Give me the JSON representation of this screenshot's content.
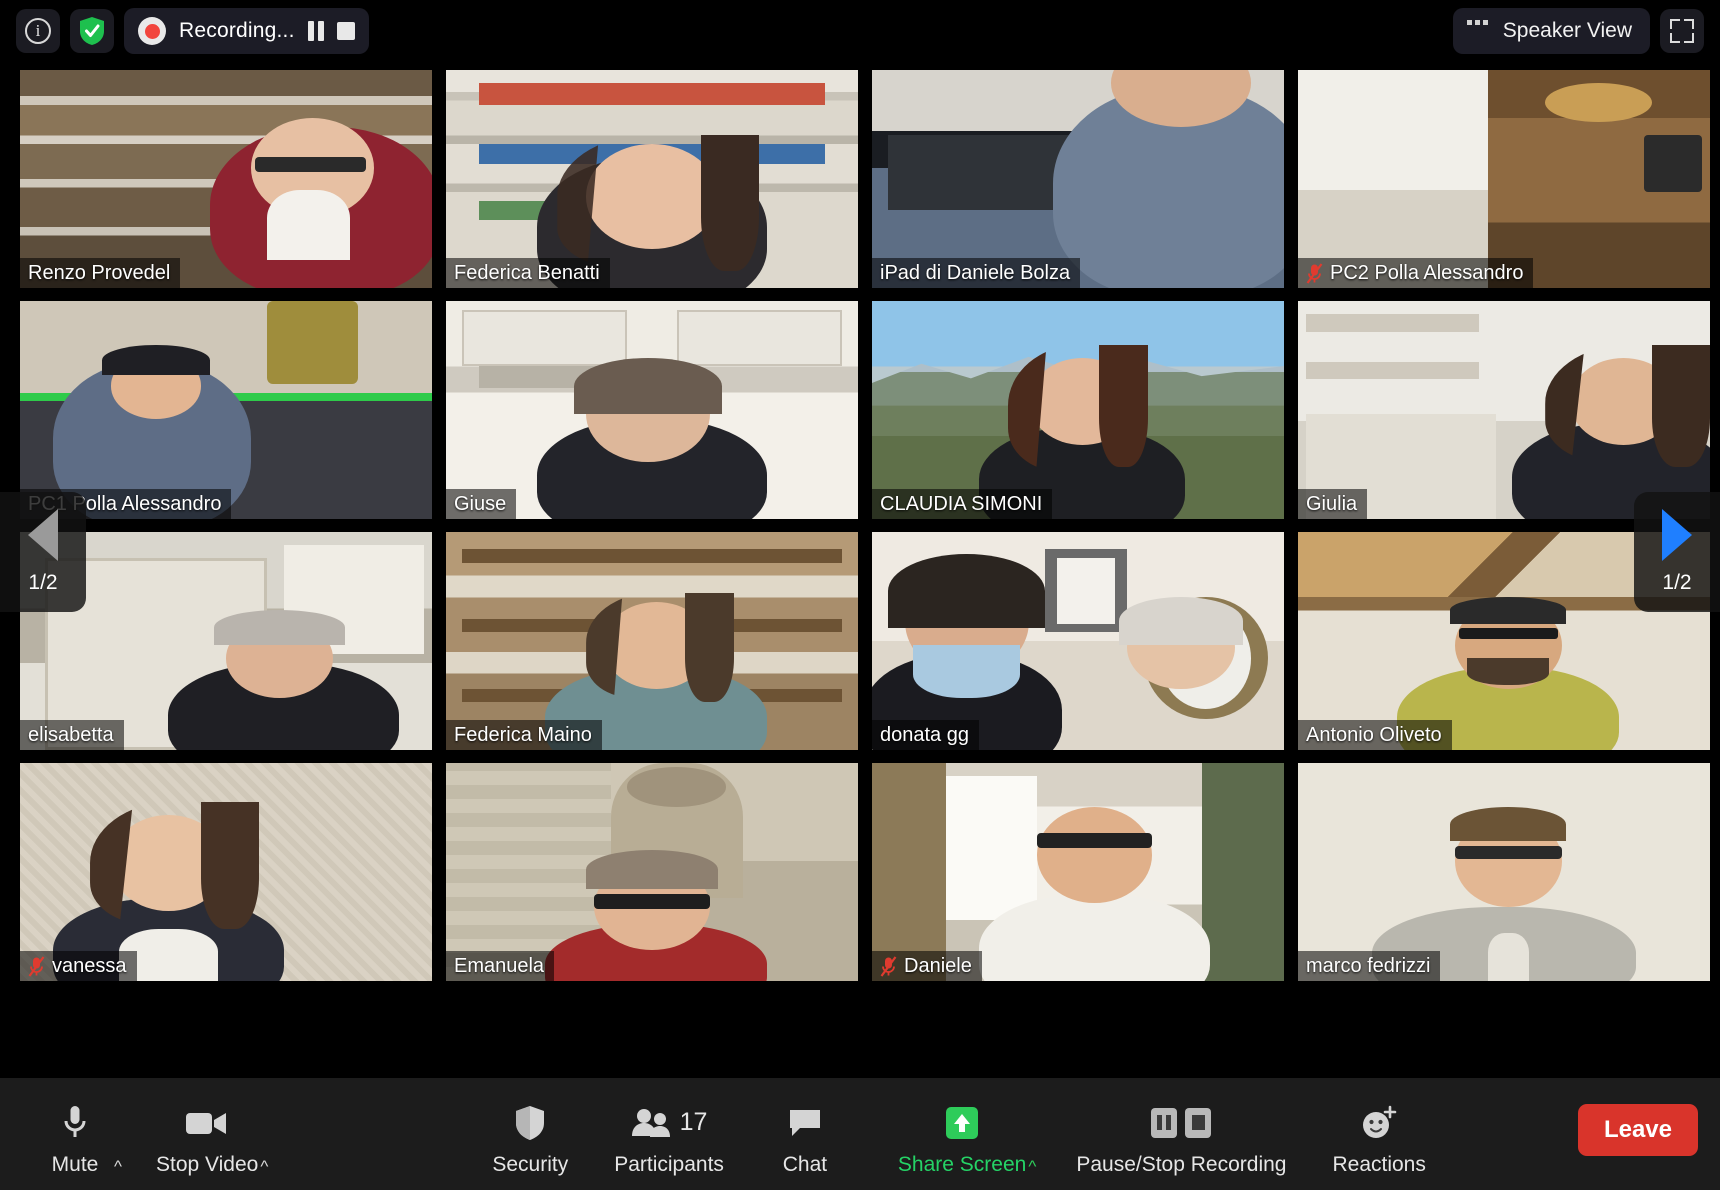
{
  "app": {
    "name": "Zoom Meeting",
    "view_mode": "gallery"
  },
  "topbar": {
    "info_icon": "info-circle-icon",
    "security_icon": "shield-check-icon",
    "recording": {
      "label": "Recording...",
      "dot_icon": "record-dot-icon",
      "pause_icon": "pause-icon",
      "stop_icon": "stop-icon",
      "dot_color": "#f2453d"
    },
    "speaker_view": {
      "label": "Speaker View",
      "icon": "grid-layout-icon"
    },
    "fullscreen": {
      "icon": "fullscreen-icon"
    }
  },
  "gallery": {
    "active_speaker_border_color": "#c9e840",
    "nav": {
      "prev": {
        "icon": "triangle-left-icon",
        "page_label": "1/2",
        "color": "#9a9a9a"
      },
      "next": {
        "icon": "triangle-right-icon",
        "page_label": "1/2",
        "color": "#1f7fff"
      }
    },
    "participants": [
      {
        "name": "Renzo Provedel",
        "muted": false,
        "active": false,
        "bg": "bg-books"
      },
      {
        "name": "Federica Benatti",
        "muted": false,
        "active": false,
        "bg": "bg-office"
      },
      {
        "name": "iPad di Daniele Bolza",
        "muted": false,
        "active": false,
        "bg": "bg-dark"
      },
      {
        "name": "PC2 Polla Alessandro",
        "muted": true,
        "active": false,
        "bg": "bg-attic"
      },
      {
        "name": "PC1 Polla Alessandro",
        "muted": false,
        "active": false,
        "bg": "bg-desk"
      },
      {
        "name": "Giuse",
        "muted": false,
        "active": false,
        "bg": "bg-kitchen"
      },
      {
        "name": "CLAUDIA SIMONI",
        "muted": false,
        "active": false,
        "bg": "bg-mount"
      },
      {
        "name": "Giulia",
        "muted": false,
        "active": false,
        "bg": "bg-white"
      },
      {
        "name": "elisabetta",
        "muted": false,
        "active": false,
        "bg": "bg-door"
      },
      {
        "name": "Federica Maino",
        "muted": false,
        "active": false,
        "bg": "bg-shelf"
      },
      {
        "name": "donata gg",
        "muted": false,
        "active": true,
        "bg": "bg-room"
      },
      {
        "name": "Antonio Oliveto",
        "muted": false,
        "active": false,
        "bg": "bg-beam"
      },
      {
        "name": "vanessa",
        "muted": true,
        "active": false,
        "bg": "bg-wall"
      },
      {
        "name": "Emanuela",
        "muted": false,
        "active": false,
        "bg": "bg-stone"
      },
      {
        "name": "Daniele",
        "muted": true,
        "active": false,
        "bg": "bg-window"
      },
      {
        "name": "marco fedrizzi",
        "muted": false,
        "active": false,
        "bg": "bg-plain"
      }
    ]
  },
  "toolbar": {
    "mute": {
      "label": "Mute",
      "icon": "microphone-icon",
      "caret": "^"
    },
    "stop_video": {
      "label": "Stop Video",
      "icon": "video-camera-icon",
      "caret": "^"
    },
    "security": {
      "label": "Security",
      "icon": "shield-icon"
    },
    "participants": {
      "label": "Participants",
      "icon": "people-icon",
      "count": "17"
    },
    "chat": {
      "label": "Chat",
      "icon": "chat-bubble-icon"
    },
    "share_screen": {
      "label": "Share Screen",
      "icon": "share-screen-icon",
      "caret": "^",
      "color": "#25d366"
    },
    "record": {
      "label": "Pause/Stop Recording",
      "pause_icon": "pause-icon",
      "stop_icon": "stop-icon"
    },
    "reactions": {
      "label": "Reactions",
      "icon": "smiley-plus-icon"
    },
    "leave": {
      "label": "Leave",
      "color": "#d9342b"
    }
  }
}
